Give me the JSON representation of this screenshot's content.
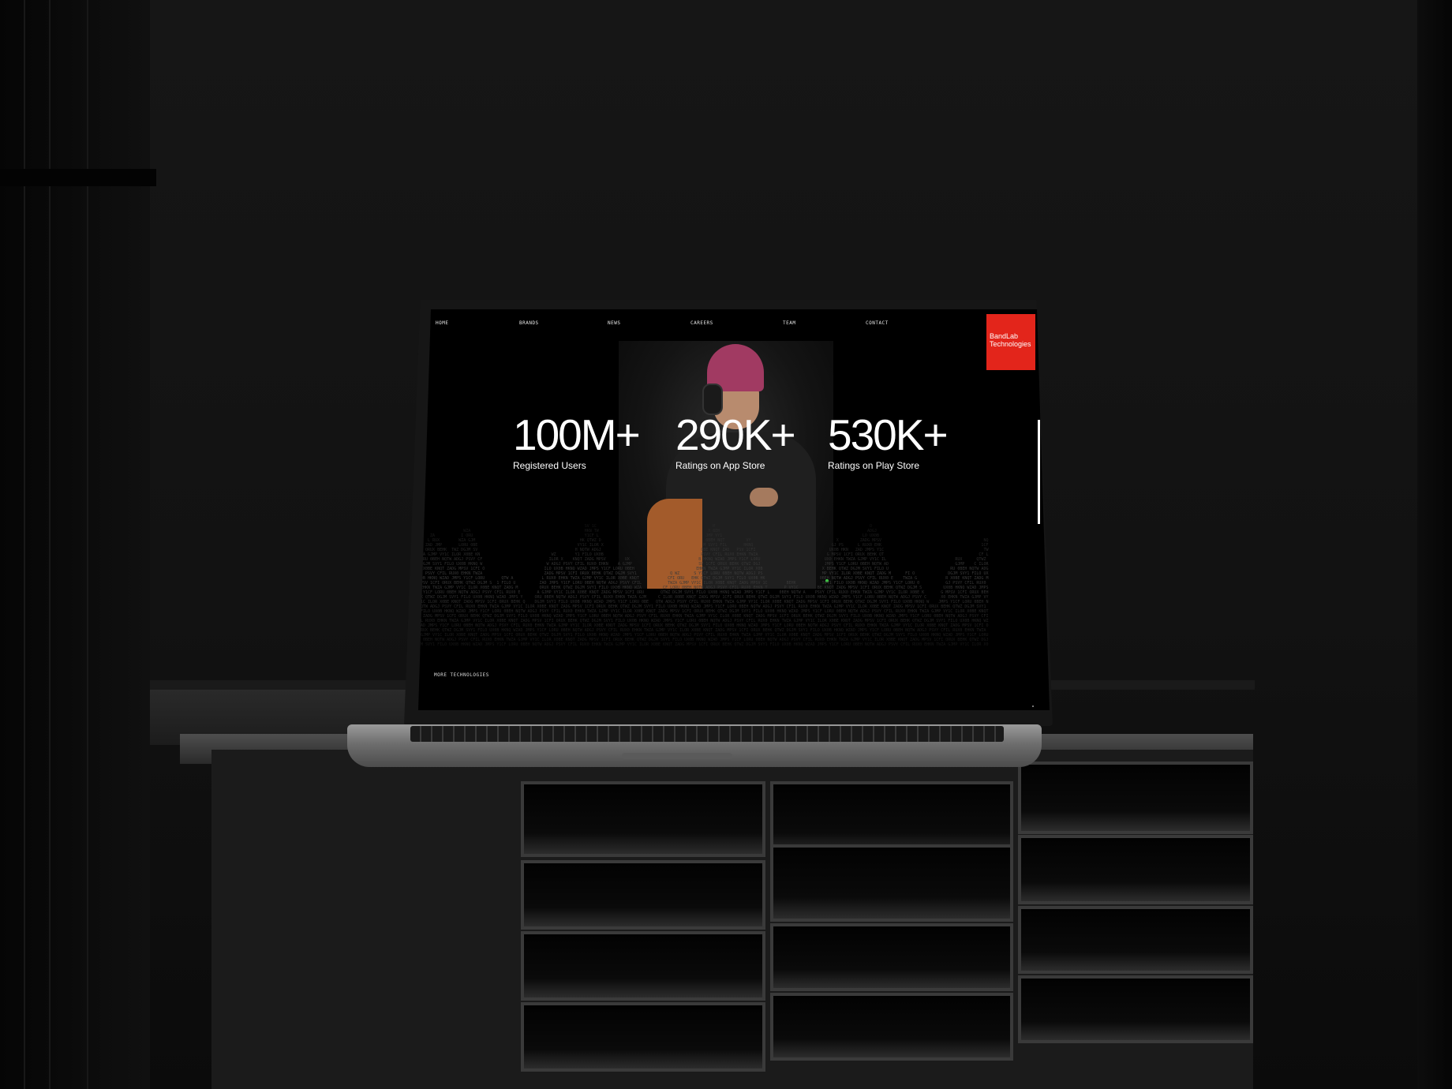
{
  "nav": {
    "items": [
      {
        "label": "HOME"
      },
      {
        "label": "BRANDS"
      },
      {
        "label": "NEWS"
      },
      {
        "label": "CAREERS"
      },
      {
        "label": "TEAM"
      },
      {
        "label": "CONTACT"
      }
    ]
  },
  "logo": {
    "line1": "BandLab",
    "line2": "Technologies",
    "color": "#e3251b"
  },
  "stats": [
    {
      "value": "100M+",
      "label": "Registered Users"
    },
    {
      "value": "290K+",
      "label": "Ratings on App Store"
    },
    {
      "value": "530K+",
      "label": "Ratings on Play Store"
    }
  ],
  "footer": {
    "more_link": "MORE TECHNOLOGIES"
  },
  "colors": {
    "accent": "#e3251b",
    "screen_bg": "#000000",
    "text": "#ffffff"
  }
}
